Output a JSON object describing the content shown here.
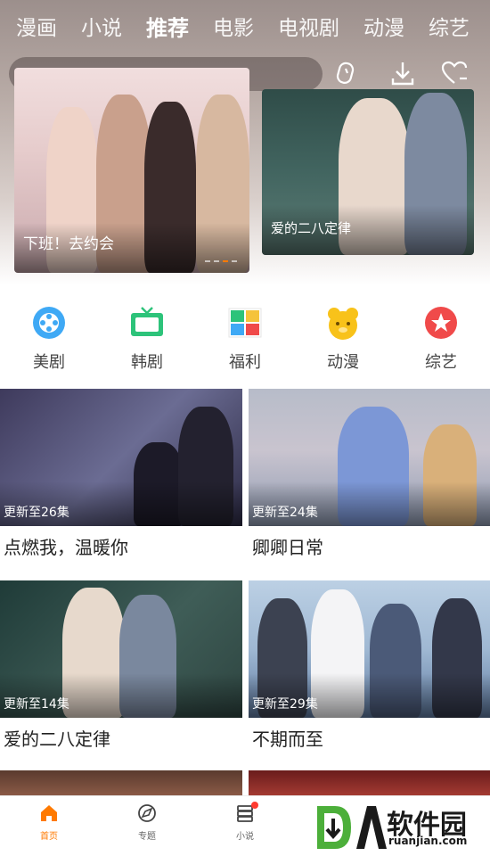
{
  "top_tabs": [
    {
      "label": "漫画",
      "active": false
    },
    {
      "label": "小说",
      "active": false
    },
    {
      "label": "推荐",
      "active": true
    },
    {
      "label": "电影",
      "active": false
    },
    {
      "label": "电视剧",
      "active": false
    },
    {
      "label": "动漫",
      "active": false
    },
    {
      "label": "综艺",
      "active": false
    }
  ],
  "header_icons": [
    "history-icon",
    "download-icon",
    "favorite-icon"
  ],
  "banners": {
    "main": {
      "title": "下班！去约会"
    },
    "side": {
      "title": "爱的二八定律"
    }
  },
  "categories": [
    {
      "label": "美剧",
      "icon": "film-reel-icon",
      "color": "#3fa9f5"
    },
    {
      "label": "韩剧",
      "icon": "tv-icon",
      "color": "#2dc37a"
    },
    {
      "label": "福利",
      "icon": "gift-grid-icon",
      "color": "#f5c33b"
    },
    {
      "label": "动漫",
      "icon": "bear-face-icon",
      "color": "#f8c21a"
    },
    {
      "label": "综艺",
      "icon": "star-badge-icon",
      "color": "#f04a4a"
    }
  ],
  "shows": [
    {
      "title": "点燃我，温暖你",
      "update": "更新至26集"
    },
    {
      "title": "卿卿日常",
      "update": "更新至24集"
    },
    {
      "title": "爱的二八定律",
      "update": "更新至14集"
    },
    {
      "title": "不期而至",
      "update": "更新至29集"
    }
  ],
  "bottom_nav": [
    {
      "label": "首页",
      "icon": "home-icon",
      "active": true
    },
    {
      "label": "专题",
      "icon": "compass-icon",
      "active": false
    },
    {
      "label": "小说",
      "icon": "book-stack-icon",
      "active": false
    }
  ],
  "watermark": {
    "cn": "软件园",
    "en": "ruanjian.com"
  },
  "colors": {
    "accent": "#ff7a00"
  }
}
